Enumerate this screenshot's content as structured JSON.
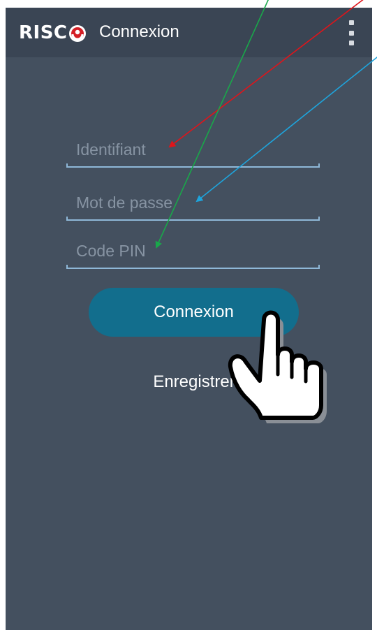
{
  "app_bar": {
    "brand": "RISC",
    "title": "Connexion",
    "menu_icon": "overflow-menu-icon"
  },
  "login_form": {
    "username_placeholder": "Identifiant",
    "username_value": "",
    "password_placeholder": "Mot de passe",
    "password_value": "",
    "pin_placeholder": "Code PIN",
    "pin_value": "",
    "connect_label": "Connexion",
    "register_label": "Enregistrer"
  },
  "annotations": {
    "hand_icon": "pointing-hand-icon",
    "arrows": [
      {
        "target": "username",
        "color": "#e0141a"
      },
      {
        "target": "password",
        "color": "#1ea4dc"
      },
      {
        "target": "pin",
        "color": "#19a84a"
      }
    ]
  },
  "colors": {
    "background": "#44505f",
    "app_bar": "#3a4554",
    "accent": "#126e8d",
    "placeholder": "#8794a3",
    "underline": "#8fb8d8"
  }
}
